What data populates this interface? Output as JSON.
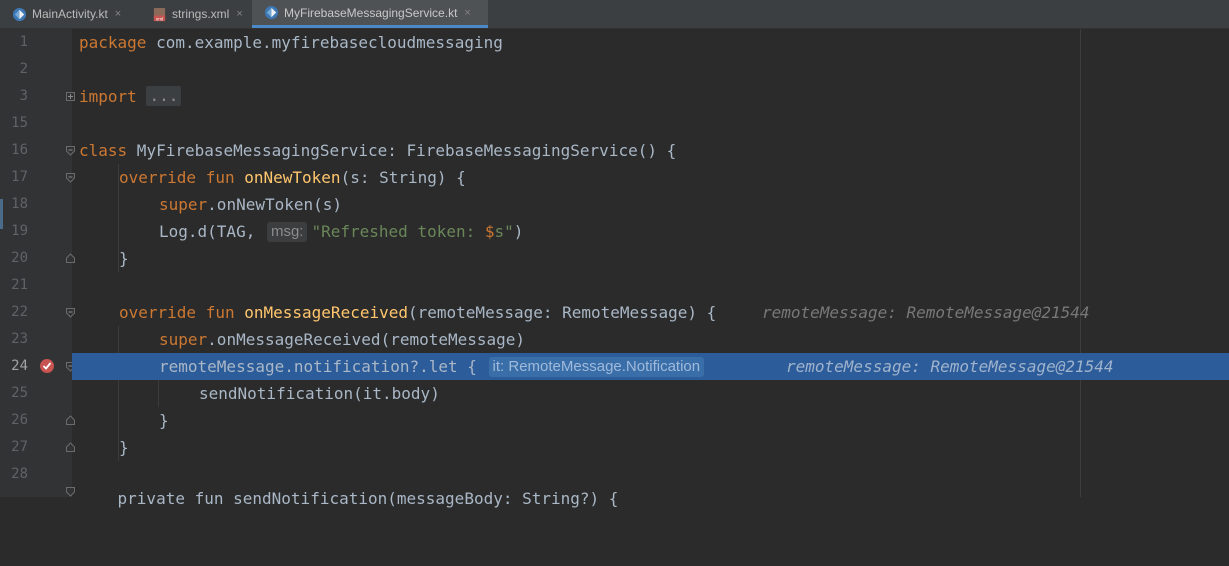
{
  "tabs": [
    {
      "label": "MainActivity.kt",
      "icon": "kotlin-file-icon",
      "active": false
    },
    {
      "label": "strings.xml",
      "icon": "xml-file-icon",
      "active": false
    },
    {
      "label": "MyFirebaseMessagingService.kt",
      "icon": "kotlin-file-icon",
      "active": true
    }
  ],
  "close_glyph": "×",
  "gutter": {
    "line_numbers": [
      "1",
      "2",
      "3",
      "15",
      "16",
      "17",
      "18",
      "19",
      "20",
      "21",
      "22",
      "23",
      "24",
      "25",
      "26",
      "27",
      "28"
    ],
    "current_line": "24",
    "breakpoint_line": "24"
  },
  "code": {
    "l1": {
      "kw": "package",
      "rest": " com.example.myfirebasecloudmessaging"
    },
    "l3": {
      "kw": "import",
      "placeholder": "..."
    },
    "l16": {
      "kw": "class",
      "rest": " MyFirebaseMessagingService: FirebaseMessagingService() {"
    },
    "l17": {
      "kw": "override fun",
      "fn": "onNewToken",
      "rest": "(s: String) {"
    },
    "l18": {
      "kw": "super",
      "rest": ".onNewToken(s)"
    },
    "l19": {
      "pre": "Log.d(TAG, ",
      "hint": "msg:",
      "str": "\"Refreshed token: ",
      "tmpl": "$",
      "str2": "s\"",
      "post": ")"
    },
    "l20": {
      "rest": "}"
    },
    "l22": {
      "kw": "override fun",
      "fn": "onMessageReceived",
      "rest": "(remoteMessage: RemoteMessage) {",
      "debug": "remoteMessage: RemoteMessage@21544"
    },
    "l23": {
      "kw": "super",
      "rest": ".onMessageReceived(remoteMessage)"
    },
    "l24": {
      "pre": "remoteMessage.notification?.let {",
      "hint": "it: RemoteMessage.Notification",
      "debug": "remoteMessage: RemoteMessage@21544"
    },
    "l25": {
      "rest": "sendNotification(it.body)"
    },
    "l26": {
      "rest": "}"
    },
    "l27": {
      "rest": "}"
    },
    "l29": {
      "rest": "    private fun sendNotification(messageBody: String?) {"
    }
  },
  "colors": {
    "editor_bg": "#2b2b2b",
    "keyword": "#cc7832",
    "function": "#ffc66d",
    "string": "#6a8759",
    "selection": "#2d5c9a"
  }
}
